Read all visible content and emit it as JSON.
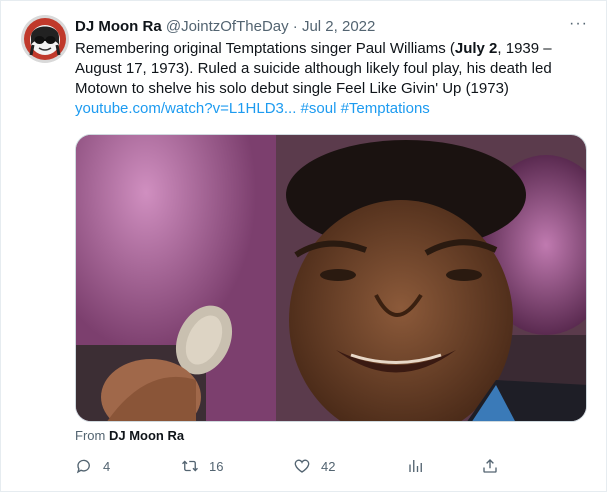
{
  "tweet": {
    "author_name": "DJ Moon Ra",
    "handle": "@JointzOfTheDay",
    "separator": "·",
    "date": "Jul 2, 2022",
    "more_label": "···",
    "text_part1": "Remembering original Temptations singer Paul Williams (",
    "text_bold": "July 2",
    "text_part2": ", 1939 – August 17, 1973). Ruled a suicide although likely foul play, his death led Motown to shelve his solo debut single Feel Like Givin' Up (1973)",
    "link_url": "youtube.com/watch?v=L1HLD3...",
    "hashtag1": "#soul",
    "hashtag2": "#Temptations",
    "from_prefix": "From",
    "from_source": "DJ Moon Ra"
  },
  "actions": {
    "reply_count": "4",
    "retweet_count": "16",
    "like_count": "42"
  },
  "icons": {
    "reply": "reply-icon",
    "retweet": "retweet-icon",
    "like": "like-icon",
    "views": "views-icon",
    "share": "share-icon"
  },
  "colors": {
    "link": "#1d9bf0",
    "secondary_text": "#536471"
  }
}
